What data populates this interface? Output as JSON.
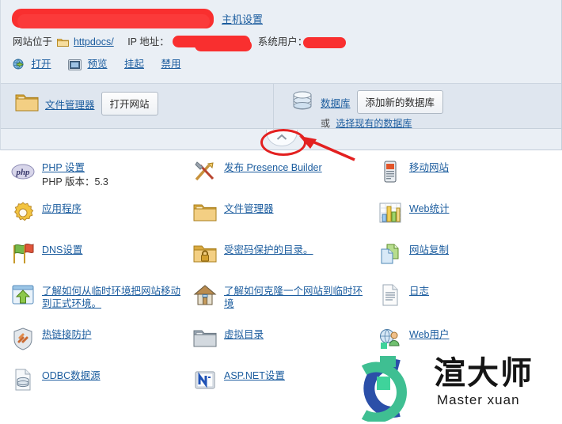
{
  "header": {
    "domain_redacted": true,
    "host_settings_link": "主机设置",
    "site_located_label": "网站位于",
    "docroot_link": "httpdocs/",
    "ip_label": "IP 地址：",
    "system_user_label": "系统用户：",
    "actions": [
      {
        "label": "打开",
        "icon": "globe-arrow-icon"
      },
      {
        "label": "预览",
        "icon": "preview-icon"
      },
      {
        "label": "挂起",
        "icon": "none"
      },
      {
        "label": "禁用",
        "icon": "none"
      }
    ]
  },
  "quick": {
    "files": {
      "icon": "folder-icon",
      "link": "文件管理器",
      "button": "打开网站"
    },
    "database": {
      "icon": "database-icon",
      "link": "数据库",
      "button": "添加新的数据库",
      "or_label": "或",
      "existing_link": "选择现有的数据库"
    },
    "collapse_icon": "chevron-up-icon"
  },
  "tools": [
    {
      "icon": "php-icon",
      "label": "PHP 设置",
      "sub": "PHP 版本：5.3",
      "col": 1,
      "row": 1
    },
    {
      "icon": "tools-icon",
      "label": "发布 Presence Builder",
      "sub": "",
      "col": 2,
      "row": 1
    },
    {
      "icon": "mobile-icon",
      "label": "移动网站",
      "sub": "",
      "col": 3,
      "row": 1
    },
    {
      "icon": "gear-icon",
      "label": "应用程序",
      "sub": "",
      "col": 1,
      "row": 2
    },
    {
      "icon": "folder-icon",
      "label": "文件管理器",
      "sub": "",
      "col": 2,
      "row": 2
    },
    {
      "icon": "chart-icon",
      "label": "Web统计",
      "sub": "",
      "col": 3,
      "row": 2
    },
    {
      "icon": "dns-flags-icon",
      "label": "DNS设置",
      "sub": "",
      "col": 1,
      "row": 3
    },
    {
      "icon": "folder-lock-icon",
      "label": "受密码保护的目录。",
      "sub": "",
      "col": 2,
      "row": 3
    },
    {
      "icon": "copy-site-icon",
      "label": "网站复制",
      "sub": "",
      "col": 3,
      "row": 3
    },
    {
      "icon": "upload-window-icon",
      "label": "了解如何从临时环境把网站移动到正式环境。",
      "sub": "",
      "col": 1,
      "row": 4
    },
    {
      "icon": "house-icon",
      "label": "了解如何克隆一个网站到临时环境",
      "sub": "",
      "col": 2,
      "row": 4
    },
    {
      "icon": "log-doc-icon",
      "label": "日志",
      "sub": "",
      "col": 3,
      "row": 4
    },
    {
      "icon": "shield-link-icon",
      "label": "热链接防护",
      "sub": "",
      "col": 1,
      "row": 5
    },
    {
      "icon": "vdir-folder-icon",
      "label": "虚拟目录",
      "sub": "",
      "col": 2,
      "row": 5
    },
    {
      "icon": "web-users-icon",
      "label": "Web用户",
      "sub": "",
      "col": 3,
      "row": 5
    },
    {
      "icon": "odbc-icon",
      "label": "ODBC数据源",
      "sub": "",
      "col": 1,
      "row": 6
    },
    {
      "icon": "aspnet-icon",
      "label": "ASP.NET设置",
      "sub": "",
      "col": 2,
      "row": 6
    }
  ],
  "watermark": {
    "title": "渲大师",
    "subtitle": "Master xuan"
  },
  "colors": {
    "panel_bg": "#eaeff5",
    "bar_bg": "#dfe6ef",
    "link": "#1b5c9e",
    "redaction": "#f92f2f",
    "annotation": "#e32020"
  }
}
